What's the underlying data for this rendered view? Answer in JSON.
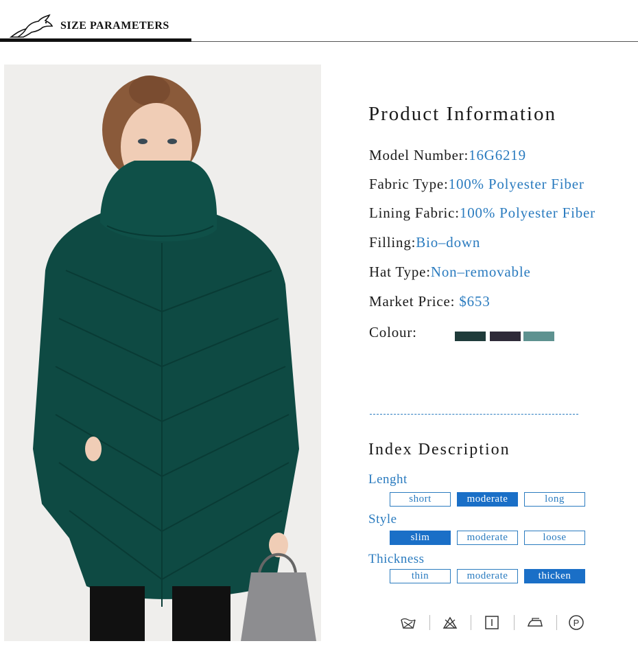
{
  "header": {
    "title": "SIZE PARAMETERS"
  },
  "product_info": {
    "title": "Product Information",
    "model_label": "Model Number:",
    "model_value": "16G6219",
    "fabric_label": "Fabric Type:",
    "fabric_value": "100% Polyester Fiber",
    "lining_label": "Lining Fabric:",
    "lining_value": "100% Polyester Fiber",
    "filling_label": "Filling:",
    "filling_value": "Bio–down",
    "hat_label": "Hat Type:",
    "hat_value": "Non–removable",
    "price_label": "Market Price: ",
    "price_value": "$653",
    "colour_label": "Colour:",
    "colours": [
      "#1f3b3a",
      "#2e2a38",
      "#5e9290"
    ]
  },
  "index": {
    "title": "Index Description",
    "length": {
      "label": "Lenght",
      "options": [
        "short",
        "moderate",
        "long"
      ],
      "selected": "moderate"
    },
    "style": {
      "label": "Style",
      "options": [
        "slim",
        "moderate",
        "loose"
      ],
      "selected": "slim"
    },
    "thickness": {
      "label": "Thickness",
      "options": [
        "thin",
        "moderate",
        "thicken"
      ],
      "selected": "thicken"
    }
  },
  "care_icons": [
    "hand-wash-icon",
    "do-not-bleach-icon",
    "tumble-dry-icon",
    "iron-icon",
    "dry-clean-icon"
  ],
  "accent_color": "#2a7bbf",
  "selected_color": "#1a6fc7"
}
